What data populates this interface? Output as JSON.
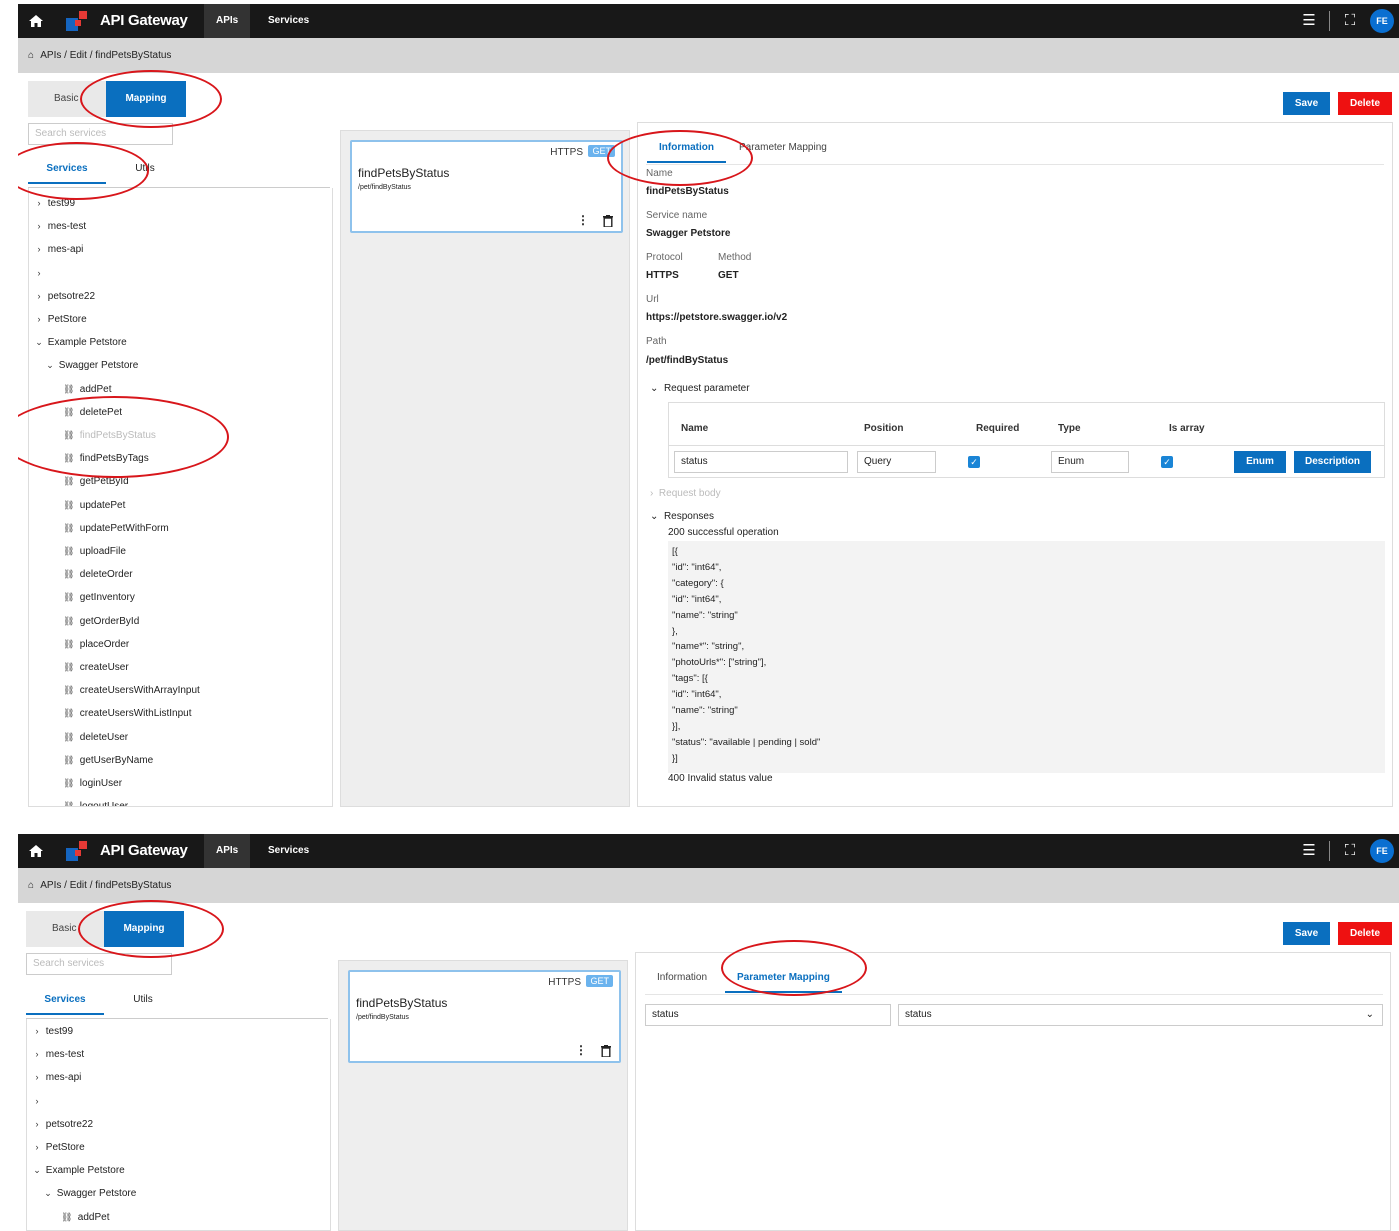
{
  "app": {
    "name": "API Gateway",
    "nav": [
      "APIs",
      "Services"
    ],
    "avatar": "FE"
  },
  "breadcrumb": "APIs / Edit / findPetsByStatus",
  "tabs": {
    "basic": "Basic",
    "mapping": "Mapping"
  },
  "actions": {
    "save": "Save",
    "delete": "Delete"
  },
  "search_placeholder": "Search services",
  "left_tabs": {
    "services": "Services",
    "utils": "Utils"
  },
  "tree": [
    {
      "label": "test99",
      "type": "folder"
    },
    {
      "label": "mes-test",
      "type": "folder"
    },
    {
      "label": "mes-api",
      "type": "folder"
    },
    {
      "label": "",
      "type": "folder"
    },
    {
      "label": "petsotre22",
      "type": "folder"
    },
    {
      "label": "PetStore",
      "type": "folder"
    },
    {
      "label": "Example Petstore",
      "type": "open"
    },
    {
      "label": "Swagger Petstore",
      "type": "open-sub"
    },
    {
      "label": "addPet",
      "type": "link"
    },
    {
      "label": "deletePet",
      "type": "link"
    },
    {
      "label": "findPetsByStatus",
      "type": "link-disabled"
    },
    {
      "label": "findPetsByTags",
      "type": "link"
    },
    {
      "label": "getPetById",
      "type": "link"
    },
    {
      "label": "updatePet",
      "type": "link"
    },
    {
      "label": "updatePetWithForm",
      "type": "link"
    },
    {
      "label": "uploadFile",
      "type": "link"
    },
    {
      "label": "deleteOrder",
      "type": "link"
    },
    {
      "label": "getInventory",
      "type": "link"
    },
    {
      "label": "getOrderById",
      "type": "link"
    },
    {
      "label": "placeOrder",
      "type": "link"
    },
    {
      "label": "createUser",
      "type": "link"
    },
    {
      "label": "createUsersWithArrayInput",
      "type": "link"
    },
    {
      "label": "createUsersWithListInput",
      "type": "link"
    },
    {
      "label": "deleteUser",
      "type": "link"
    },
    {
      "label": "getUserByName",
      "type": "link"
    },
    {
      "label": "loginUser",
      "type": "link"
    },
    {
      "label": "logoutUser",
      "type": "link"
    }
  ],
  "card": {
    "protocol": "HTTPS",
    "method": "GET",
    "title": "findPetsByStatus",
    "path": "/pet/findByStatus"
  },
  "right_tabs": {
    "information": "Information",
    "parameter_mapping": "Parameter Mapping"
  },
  "info": {
    "name_label": "Name",
    "name": "findPetsByStatus",
    "service_label": "Service name",
    "service": "Swagger Petstore",
    "protocol_label": "Protocol",
    "protocol": "HTTPS",
    "method_label": "Method",
    "method": "GET",
    "url_label": "Url",
    "url": "https://petstore.swagger.io/v2",
    "path_label": "Path",
    "path": "/pet/findByStatus"
  },
  "request_parameter": {
    "title": "Request parameter",
    "headers": [
      "Name",
      "Position",
      "Required",
      "Type",
      "Is array"
    ],
    "row": {
      "name": "status",
      "position": "Query",
      "required": true,
      "type": "Enum",
      "is_array": true
    },
    "buttons": {
      "enum": "Enum",
      "description": "Description"
    }
  },
  "request_body": "Request body",
  "responses": {
    "title": "Responses",
    "ok": "200 successful operation",
    "code": "[{\n\"id\": \"int64\",\n\"category\": {\n\"id\": \"int64\",\n\"name\": \"string\"\n},\n\"name*\": \"string\",\n\"photoUrls*\": [\"string\"],\n\"tags\": [{\n\"id\": \"int64\",\n\"name\": \"string\"\n}],\n\"status\": \"available | pending | sold\"\n}]",
    "bad": "400 Invalid status value"
  },
  "mapping": {
    "source": "status",
    "target": "status"
  }
}
